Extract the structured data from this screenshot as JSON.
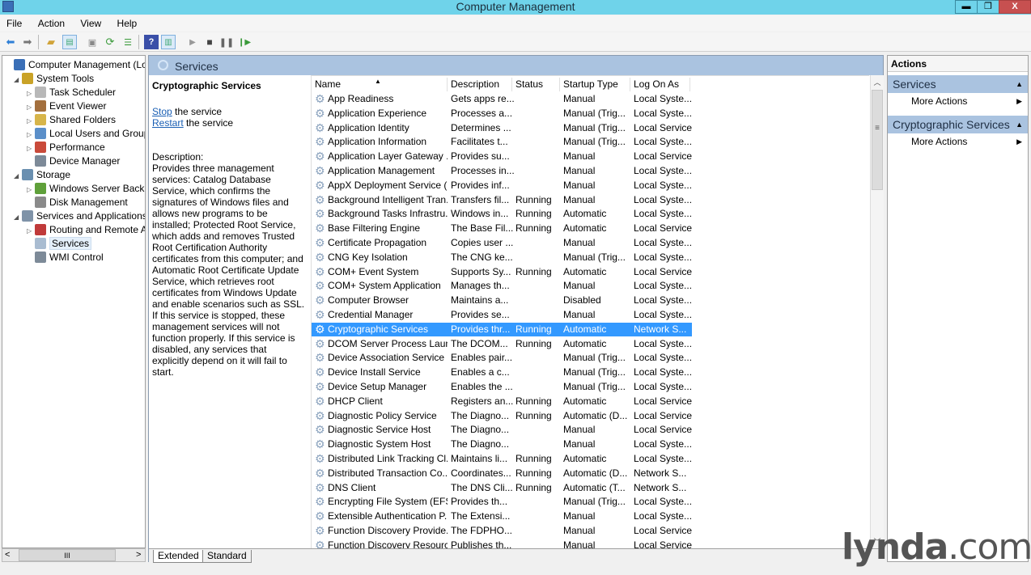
{
  "window": {
    "title": "Computer Management",
    "controls": {
      "minimize": "▬",
      "restore": "❐",
      "close": "X"
    }
  },
  "menu": [
    "File",
    "Action",
    "View",
    "Help"
  ],
  "toolbar_icons": [
    "back-icon",
    "forward-icon",
    "up-folder-icon",
    "show-hide-console-tree-icon",
    "properties-icon",
    "refresh-icon",
    "export-list-icon",
    "help-icon",
    "show-hide-action-pane-icon",
    "start-service-icon",
    "stop-service-icon",
    "pause-service-icon",
    "resume-service-icon"
  ],
  "tree": [
    {
      "label": "Computer Management (Local",
      "level": 0,
      "expander": "",
      "icon_color": "#3a6fb7"
    },
    {
      "label": "System Tools",
      "level": 1,
      "expander": "◢",
      "icon_color": "#c9a227"
    },
    {
      "label": "Task Scheduler",
      "level": 2,
      "expander": "▷",
      "icon_color": "#b8b8b8"
    },
    {
      "label": "Event Viewer",
      "level": 2,
      "expander": "▷",
      "icon_color": "#a36f3d"
    },
    {
      "label": "Shared Folders",
      "level": 2,
      "expander": "▷",
      "icon_color": "#d7b54a"
    },
    {
      "label": "Local Users and Groups",
      "level": 2,
      "expander": "▷",
      "icon_color": "#5b8fc9"
    },
    {
      "label": "Performance",
      "level": 2,
      "expander": "▷",
      "icon_color": "#c94a3a"
    },
    {
      "label": "Device Manager",
      "level": 2,
      "expander": "",
      "icon_color": "#7d8a98"
    },
    {
      "label": "Storage",
      "level": 1,
      "expander": "◢",
      "icon_color": "#6a8fb0"
    },
    {
      "label": "Windows Server Backup",
      "level": 2,
      "expander": "▷",
      "icon_color": "#5fa03a"
    },
    {
      "label": "Disk Management",
      "level": 2,
      "expander": "",
      "icon_color": "#8a8a8a"
    },
    {
      "label": "Services and Applications",
      "level": 1,
      "expander": "◢",
      "icon_color": "#7f93a8"
    },
    {
      "label": "Routing and Remote Ac",
      "level": 2,
      "expander": "▷",
      "icon_color": "#c03a3a"
    },
    {
      "label": "Services",
      "level": 2,
      "expander": "",
      "icon_color": "#a9bcd1",
      "selected": true
    },
    {
      "label": "WMI Control",
      "level": 2,
      "expander": "",
      "icon_color": "#7d8a98"
    }
  ],
  "tree_scrollbar": {
    "left": "<",
    "grip": "III",
    "right": ">"
  },
  "center": {
    "header": "Services",
    "detail": {
      "title": "Cryptographic Services",
      "stop_link": "Stop",
      "stop_text": " the service",
      "restart_link": "Restart",
      "restart_text": " the service",
      "desc_label": "Description:",
      "description": "Provides three management services: Catalog Database Service, which confirms the signatures of Windows files and allows new programs to be installed; Protected Root Service, which adds and removes Trusted Root Certification Authority certificates from this computer; and Automatic Root Certificate Update Service, which retrieves root certificates from Windows Update and enable scenarios such as SSL. If this service is stopped, these management services will not function properly. If this service is disabled, any services that explicitly depend on it will fail to start."
    },
    "columns": [
      "Name",
      "Description",
      "Status",
      "Startup Type",
      "Log On As"
    ],
    "sort_indicator": "▲",
    "rows": [
      [
        "App Readiness",
        "Gets apps re...",
        "",
        "Manual",
        "Local Syste..."
      ],
      [
        "Application Experience",
        "Processes a...",
        "",
        "Manual (Trig...",
        "Local Syste..."
      ],
      [
        "Application Identity",
        "Determines ...",
        "",
        "Manual (Trig...",
        "Local Service"
      ],
      [
        "Application Information",
        "Facilitates t...",
        "",
        "Manual (Trig...",
        "Local Syste..."
      ],
      [
        "Application Layer Gateway ...",
        "Provides su...",
        "",
        "Manual",
        "Local Service"
      ],
      [
        "Application Management",
        "Processes in...",
        "",
        "Manual",
        "Local Syste..."
      ],
      [
        "AppX Deployment Service (...",
        "Provides inf...",
        "",
        "Manual",
        "Local Syste..."
      ],
      [
        "Background Intelligent Tran...",
        "Transfers fil...",
        "Running",
        "Manual",
        "Local Syste..."
      ],
      [
        "Background Tasks Infrastru...",
        "Windows in...",
        "Running",
        "Automatic",
        "Local Syste..."
      ],
      [
        "Base Filtering Engine",
        "The Base Fil...",
        "Running",
        "Automatic",
        "Local Service"
      ],
      [
        "Certificate Propagation",
        "Copies user ...",
        "",
        "Manual",
        "Local Syste..."
      ],
      [
        "CNG Key Isolation",
        "The CNG ke...",
        "",
        "Manual (Trig...",
        "Local Syste..."
      ],
      [
        "COM+ Event System",
        "Supports Sy...",
        "Running",
        "Automatic",
        "Local Service"
      ],
      [
        "COM+ System Application",
        "Manages th...",
        "",
        "Manual",
        "Local Syste..."
      ],
      [
        "Computer Browser",
        "Maintains a...",
        "",
        "Disabled",
        "Local Syste..."
      ],
      [
        "Credential Manager",
        "Provides se...",
        "",
        "Manual",
        "Local Syste..."
      ],
      [
        "Cryptographic Services",
        "Provides thr...",
        "Running",
        "Automatic",
        "Network S..."
      ],
      [
        "DCOM Server Process Laun...",
        "The DCOM...",
        "Running",
        "Automatic",
        "Local Syste..."
      ],
      [
        "Device Association Service",
        "Enables pair...",
        "",
        "Manual (Trig...",
        "Local Syste..."
      ],
      [
        "Device Install Service",
        "Enables a c...",
        "",
        "Manual (Trig...",
        "Local Syste..."
      ],
      [
        "Device Setup Manager",
        "Enables the ...",
        "",
        "Manual (Trig...",
        "Local Syste..."
      ],
      [
        "DHCP Client",
        "Registers an...",
        "Running",
        "Automatic",
        "Local Service"
      ],
      [
        "Diagnostic Policy Service",
        "The Diagno...",
        "Running",
        "Automatic (D...",
        "Local Service"
      ],
      [
        "Diagnostic Service Host",
        "The Diagno...",
        "",
        "Manual",
        "Local Service"
      ],
      [
        "Diagnostic System Host",
        "The Diagno...",
        "",
        "Manual",
        "Local Syste..."
      ],
      [
        "Distributed Link Tracking Cl...",
        "Maintains li...",
        "Running",
        "Automatic",
        "Local Syste..."
      ],
      [
        "Distributed Transaction Co...",
        "Coordinates...",
        "Running",
        "Automatic (D...",
        "Network S..."
      ],
      [
        "DNS Client",
        "The DNS Cli...",
        "Running",
        "Automatic (T...",
        "Network S..."
      ],
      [
        "Encrypting File System (EFS)",
        "Provides th...",
        "",
        "Manual (Trig...",
        "Local Syste..."
      ],
      [
        "Extensible Authentication P...",
        "The Extensi...",
        "",
        "Manual",
        "Local Syste..."
      ],
      [
        "Function Discovery Provide...",
        "The FDPHO...",
        "",
        "Manual",
        "Local Service"
      ],
      [
        "Function Discovery Resourc...",
        "Publishes th...",
        "",
        "Manual",
        "Local Service"
      ]
    ],
    "selected_row": 16,
    "tabs": [
      "Extended",
      "Standard"
    ]
  },
  "actions": {
    "header": "Actions",
    "sections": [
      {
        "title": "Services",
        "item": "More Actions"
      },
      {
        "title": "Cryptographic Services",
        "item": "More Actions"
      }
    ]
  },
  "watermark": {
    "brand": "lynda",
    "suffix": ".com"
  }
}
